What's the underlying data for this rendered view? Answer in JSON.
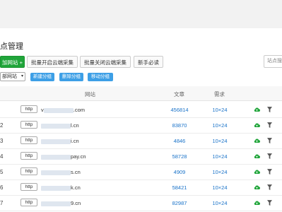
{
  "page": {
    "title": "点管理"
  },
  "toolbar": {
    "add_label": "加网站 +",
    "batch_open_label": "批量开启云端采集",
    "batch_close_label": "批量关闭云端采集",
    "newbie_label": "新手必读",
    "search_placeholder": "站点搜"
  },
  "filter": {
    "group_select_value": "部网站",
    "new_group_label": "新建分组",
    "delete_group_label": "删除分组",
    "move_group_label": "移动分组"
  },
  "table": {
    "headers": {
      "site": "网站",
      "articles": "文章",
      "demand": "需求"
    },
    "rows": [
      {
        "index": "",
        "protocol": "http",
        "host_visible": "v",
        "host_suffix": ".com",
        "articles": "456814",
        "demand": "10×24"
      },
      {
        "index": "2",
        "protocol": "http",
        "host_visible": "",
        "host_suffix": "l.cn",
        "articles": "83870",
        "demand": "10×24"
      },
      {
        "index": "3",
        "protocol": "http",
        "host_visible": "",
        "host_suffix": "i.cn",
        "articles": "4846",
        "demand": "10×24"
      },
      {
        "index": "4",
        "protocol": "http",
        "host_visible": "",
        "host_suffix": "pay.cn",
        "articles": "58728",
        "demand": "10×24"
      },
      {
        "index": "5",
        "protocol": "http",
        "host_visible": "",
        "host_suffix": "s.cn",
        "articles": "4909",
        "demand": "10×24"
      },
      {
        "index": "6",
        "protocol": "http",
        "host_visible": "",
        "host_suffix": "k.cn",
        "articles": "58421",
        "demand": "10×24"
      },
      {
        "index": "7",
        "protocol": "http",
        "host_visible": "",
        "host_suffix": "9.cn",
        "articles": "82987",
        "demand": "10×24"
      }
    ]
  },
  "icons": {
    "cloud": "cloud-upload-icon",
    "filter": "filter-icon"
  },
  "colors": {
    "green": "#20a53a",
    "blue_button": "#3d9fe6",
    "link_number": "#1a73c9"
  }
}
